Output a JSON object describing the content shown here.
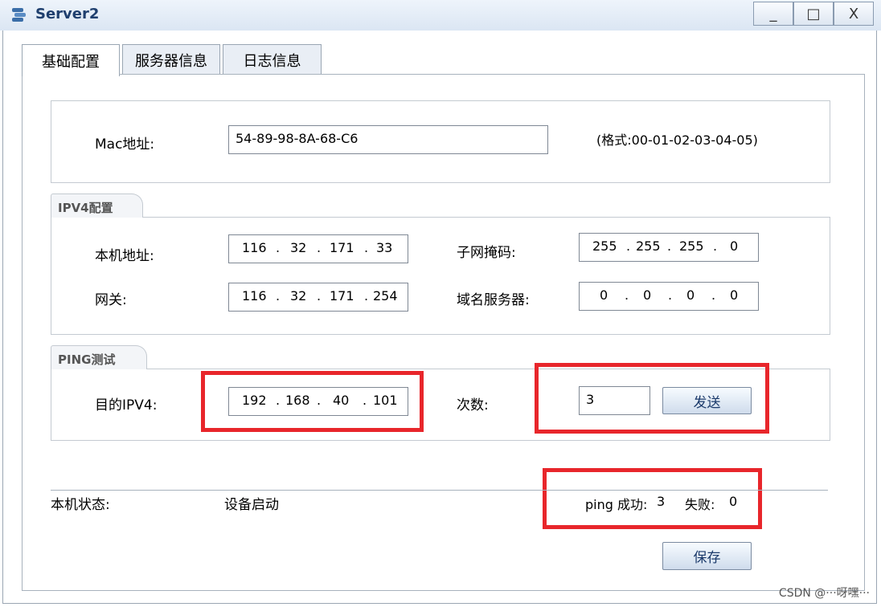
{
  "window": {
    "title": "Server2",
    "minimize": "_",
    "maximize": "□",
    "close": "X"
  },
  "tabs": [
    {
      "label": "基础配置"
    },
    {
      "label": "服务器信息"
    },
    {
      "label": "日志信息"
    }
  ],
  "mac": {
    "label": "Mac地址:",
    "value": "54-89-98-8A-68-C6",
    "format_hint": "(格式:00-01-02-03-04-05)"
  },
  "ipv4": {
    "legend": "IPV4配置",
    "local_label": "本机地址:",
    "local": [
      "116",
      "32",
      "171",
      "33"
    ],
    "mask_label": "子网掩码:",
    "mask": [
      "255",
      "255",
      "255",
      "0"
    ],
    "gateway_label": "网关:",
    "gateway": [
      "116",
      "32",
      "171",
      "254"
    ],
    "dns_label": "域名服务器:",
    "dns": [
      "0",
      "0",
      "0",
      "0"
    ]
  },
  "ping": {
    "legend": "PING测试",
    "target_label": "目的IPV4:",
    "target": [
      "192",
      "168",
      "40",
      "101"
    ],
    "count_label": "次数:",
    "count": "3",
    "send": "发送"
  },
  "status": {
    "label": "本机状态:",
    "value": "设备启动",
    "success_label": "ping 成功:",
    "success": "3",
    "fail_label": "失败:",
    "fail": "0"
  },
  "save": "保存",
  "watermark": "CSDN @···呀嘿···",
  "colors": {
    "highlight": "#e8262b",
    "title": "#1f3f6e"
  }
}
